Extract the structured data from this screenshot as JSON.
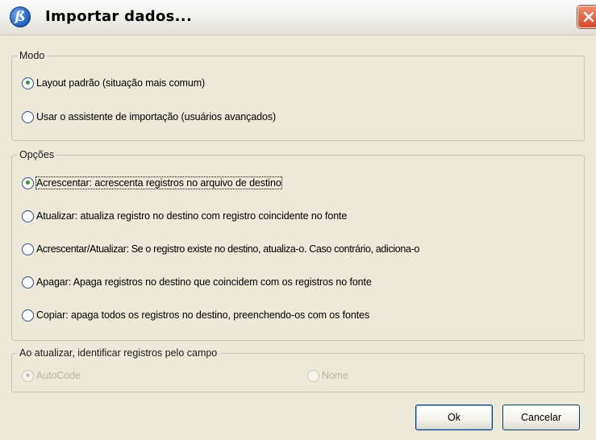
{
  "window": {
    "title": "Importar dados...",
    "app_icon_glyph": "ß",
    "close_icon": "close-icon"
  },
  "modo": {
    "legend": "Modo",
    "options": [
      {
        "label": "Layout padrão (situação mais comum)",
        "checked": true
      },
      {
        "label": "Usar o assistente de importação (usuários avançados)",
        "checked": false
      }
    ]
  },
  "opcoes": {
    "legend": "Opções",
    "options": [
      {
        "label": "Acrescentar: acrescenta registros no arquivo de destino",
        "checked": true
      },
      {
        "label": "Atualizar: atualiza registro no destino com registro coincidente no fonte",
        "checked": false
      },
      {
        "label": "Acrescentar/Atualizar: Se o registro existe no destino, atualiza-o. Caso contrário, adiciona-o",
        "checked": false
      },
      {
        "label": "Apagar: Apaga registros no destino que coincidem com os registros no fonte",
        "checked": false
      },
      {
        "label": "Copiar: apaga todos os registros no destino, preenchendo-os com os fontes",
        "checked": false
      }
    ]
  },
  "identificar": {
    "legend": "Ao atualizar, identificar registros pelo campo",
    "options": [
      {
        "label": "AutoCode",
        "checked": true,
        "disabled": true
      },
      {
        "label": "Nome",
        "checked": false,
        "disabled": true
      }
    ]
  },
  "buttons": {
    "ok": "Ok",
    "cancel": "Cancelar"
  },
  "colors": {
    "dialog_bg": "#ece9d8",
    "radio_dot": "#2d9a2d",
    "close_button": "#d9462a"
  }
}
